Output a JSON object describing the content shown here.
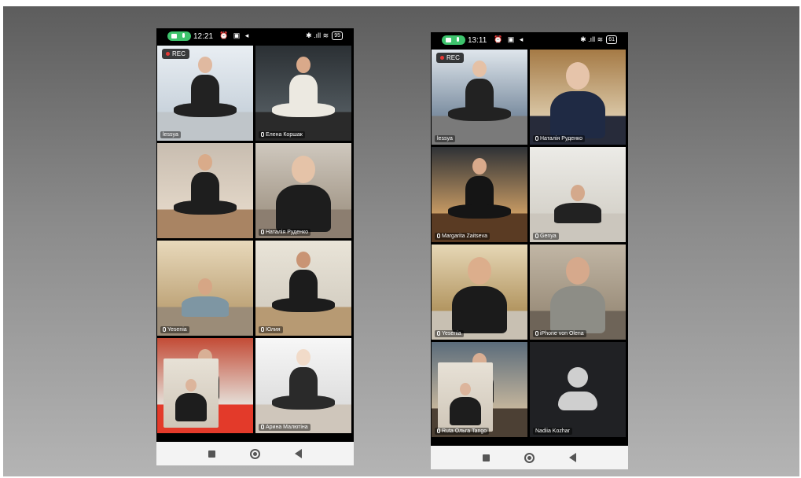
{
  "phones": [
    {
      "status": {
        "time": "12:21",
        "left_icons": "⏰ ▣ ◂",
        "right_icons": "✱ .ıll ≋",
        "battery": "95"
      },
      "rec_label": "REC",
      "tiles": [
        {
          "name": "lessya",
          "active": true,
          "rec": true,
          "palette": [
            "#e9eef3",
            "#c9d3dc"
          ],
          "skin": "#e0b9a0",
          "cloth": "#222",
          "floor": "#bfc5c9",
          "pose": "seated"
        },
        {
          "name": "Елена Коршак",
          "palette": [
            "#2b3034",
            "#50585d"
          ],
          "skin": "#d9a98a",
          "cloth": "#ece9e1",
          "floor": "#2a2a2a",
          "pose": "seated"
        },
        {
          "name": "",
          "palette": [
            "#c8bdb0",
            "#e2d6c7"
          ],
          "skin": "#d9ab8a",
          "cloth": "#1e1e1e",
          "floor": "#a98463",
          "pose": "seated"
        },
        {
          "name": "Наталія Руденко",
          "palette": [
            "#cfc8be",
            "#a69b8c"
          ],
          "skin": "#e5c3a8",
          "cloth": "#1d1d1d",
          "floor": "#8c7e70",
          "pose": "portrait"
        },
        {
          "name": "Yesenia",
          "palette": [
            "#e8d9bb",
            "#bfa57a"
          ],
          "skin": "#d6a685",
          "cloth": "#7e96a3",
          "floor": "#9b8c78",
          "pose": "lying"
        },
        {
          "name": "Юлия",
          "palette": [
            "#e9e4d8",
            "#d5cfc3"
          ],
          "skin": "#c99474",
          "cloth": "#1c1c1c",
          "floor": "#b79a73",
          "pose": "seated"
        },
        {
          "name": "",
          "palette": [
            "#c34b36",
            "#e5dfd8"
          ],
          "skin": "#d8b096",
          "cloth": "#1f1f1f",
          "floor": "#e33a2a",
          "pose": "pip"
        },
        {
          "name": "Арина Малютіна",
          "palette": [
            "#f7f7f7",
            "#dedede"
          ],
          "skin": "#f1dbc9",
          "cloth": "#2a2a2a",
          "floor": "#cfc6bb",
          "pose": "seated"
        }
      ]
    },
    {
      "status": {
        "time": "13:11",
        "left_icons": "⏰ ▣ ◂",
        "right_icons": "✱ .ıll ≋",
        "battery": "61"
      },
      "rec_label": "REC",
      "tiles": [
        {
          "name": "lessya",
          "active": true,
          "rec": true,
          "palette": [
            "#dfe6ec",
            "#7b8da0"
          ],
          "skin": "#e5c1a6",
          "cloth": "#222",
          "floor": "#7a7a7a",
          "pose": "seated"
        },
        {
          "name": "Наталія Руденко",
          "palette": [
            "#a57a45",
            "#d9c6a5"
          ],
          "skin": "#e6c4aa",
          "cloth": "#1f2a44",
          "floor": "#272b3a",
          "pose": "portrait"
        },
        {
          "name": "Margarita Zaitseva",
          "palette": [
            "#2f3236",
            "#c79a63"
          ],
          "skin": "#d9aa8b",
          "cloth": "#151515",
          "floor": "#5a3b23",
          "pose": "seated"
        },
        {
          "name": "Genya",
          "palette": [
            "#ecebe7",
            "#d6d3cb"
          ],
          "skin": "#d4a98c",
          "cloth": "#222",
          "floor": "#cbc6bd",
          "pose": "lying"
        },
        {
          "name": "Yesenia",
          "palette": [
            "#e6d7b6",
            "#b29560"
          ],
          "skin": "#dcae8c",
          "cloth": "#1b1b1b",
          "floor": "#c8c0b2",
          "pose": "portrait"
        },
        {
          "name": "iPhone von Olena",
          "palette": [
            "#c1b6a5",
            "#9c8f7c"
          ],
          "skin": "#d6a98c",
          "cloth": "#8d8d86",
          "floor": "#6e6458",
          "pose": "portrait"
        },
        {
          "name": "Ruta Ольга Tango",
          "palette": [
            "#5b6c7b",
            "#c4b59c"
          ],
          "skin": "#d9ae93",
          "cloth": "#1b1b1b",
          "floor": "#4c4034",
          "pose": "pip"
        },
        {
          "name": "Nadiia Kozhar",
          "avatar": true
        }
      ]
    }
  ]
}
